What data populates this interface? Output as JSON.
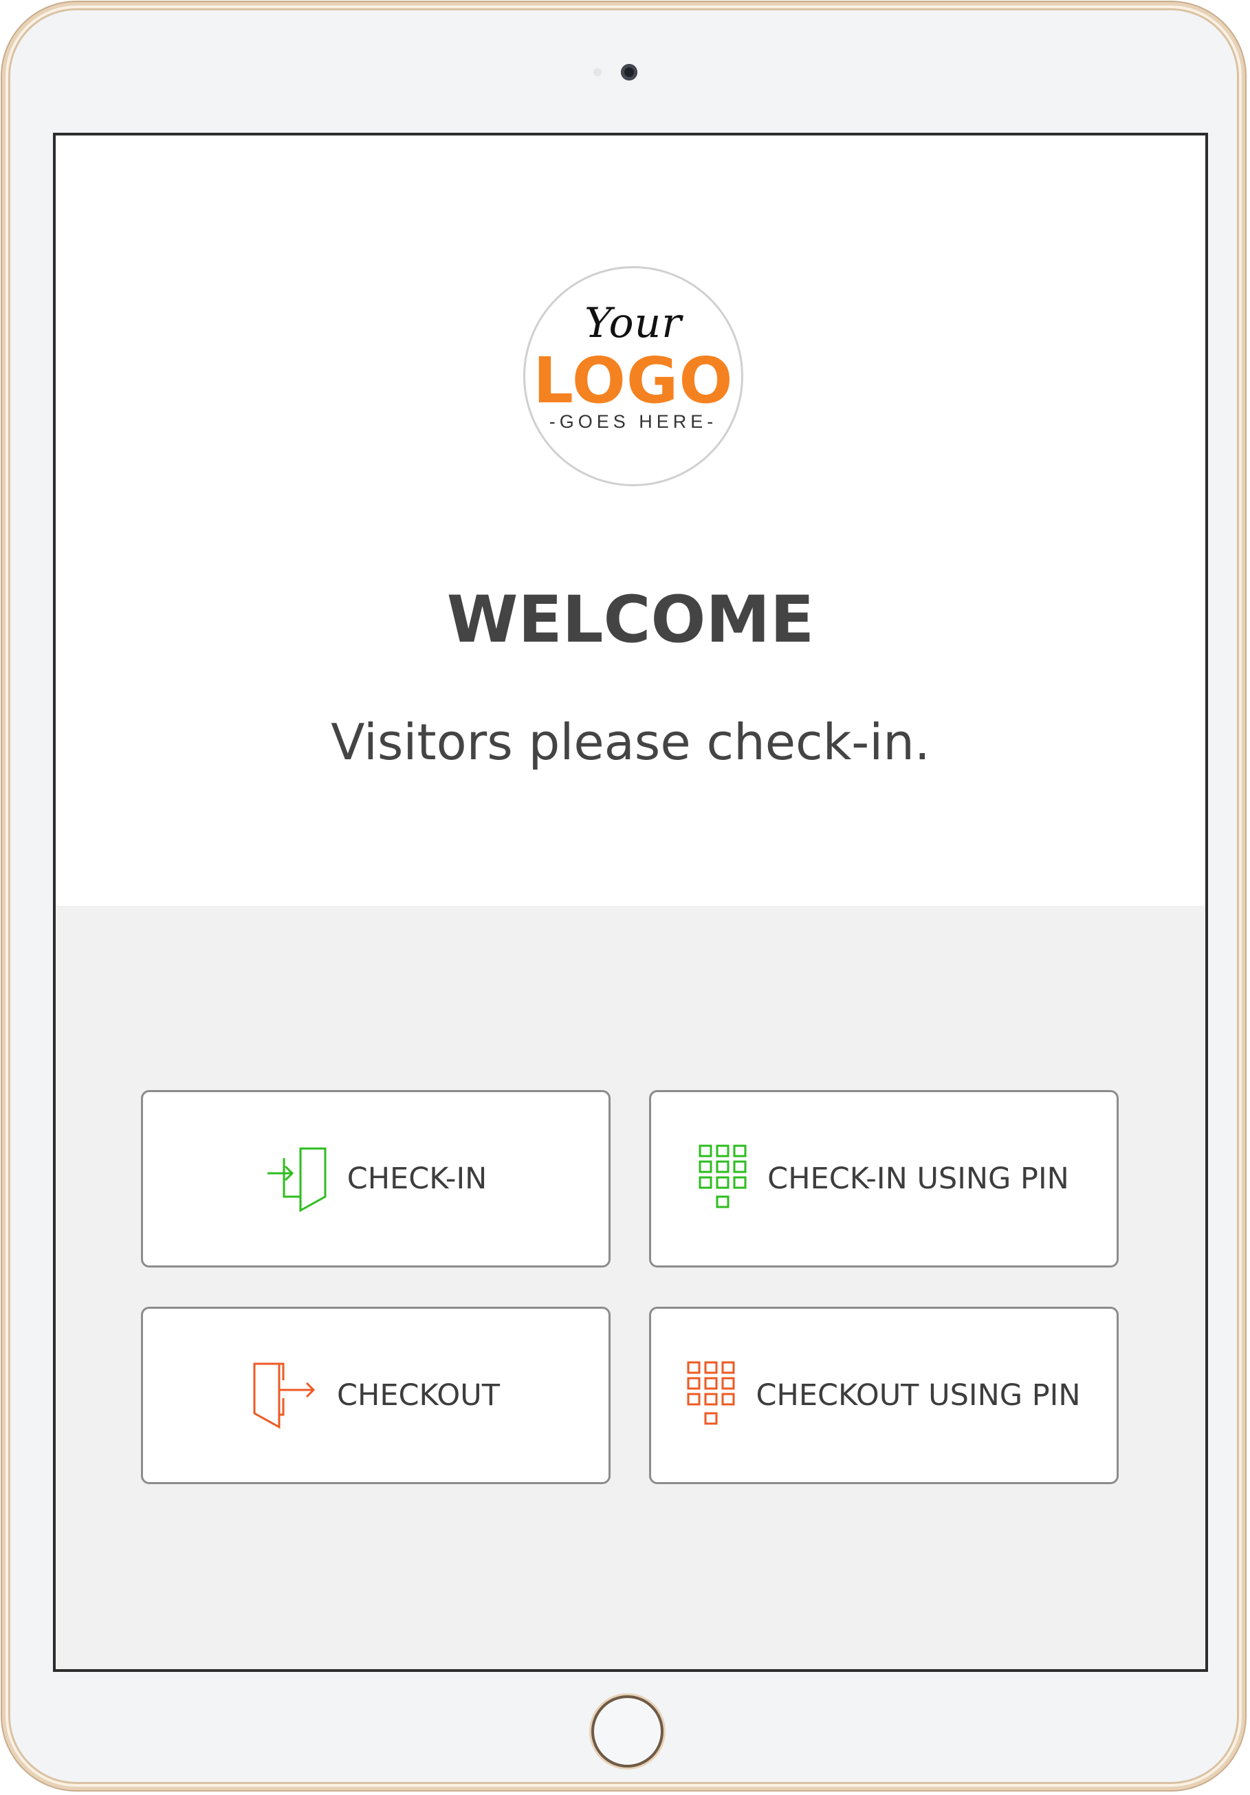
{
  "logo": {
    "line1": "Your",
    "line2": "LOGO",
    "line3": "-GOES HERE-"
  },
  "welcome": {
    "title": "WELCOME",
    "subtitle": "Visitors please check-in."
  },
  "actions": [
    {
      "label": "CHECK-IN",
      "icon": "door-enter-icon",
      "color": "#2ebd1f"
    },
    {
      "label": "CHECK-IN USING PIN",
      "icon": "keypad-icon",
      "color": "#2ebd1f"
    },
    {
      "label": "CHECKOUT",
      "icon": "door-exit-icon",
      "color": "#ee5a24"
    },
    {
      "label": "CHECKOUT USING PIN",
      "icon": "keypad-icon",
      "color": "#ee5a24"
    }
  ],
  "colors": {
    "logo_accent": "#f58220",
    "checkin": "#2ebd1f",
    "checkout": "#ee5a24"
  }
}
